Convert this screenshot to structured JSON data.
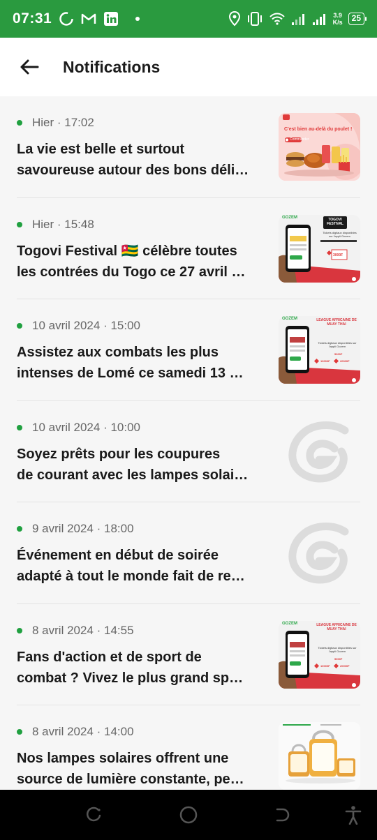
{
  "status_bar": {
    "time": "07:31",
    "net_speed_top": "3.9",
    "net_speed_bottom": "K/s",
    "battery": "25"
  },
  "header": {
    "title": "Notifications"
  },
  "notifications": [
    {
      "date": "Hier · 17:02",
      "title_line1": "La vie est belle et surtout",
      "title_line2": "savoureuse autour des bons déli…",
      "thumb": "poulet-promo",
      "thumb_text": {
        "headline": "C'est bien au-delà du poulet !",
        "cta": "Commander"
      }
    },
    {
      "date": "Hier · 15:48",
      "title_line1": "Togovi Festival 🇹🇬 célèbre toutes",
      "title_line2": "les contrées du Togo ce 27 avril …",
      "thumb": "gozem-ticket",
      "thumb_text": {
        "brand": "GOZEM",
        "banner": "TOGOVI FESTIVAL",
        "tagline": "Tickets digitaux disponibles sur l'appli Gozem",
        "price": "3000F"
      }
    },
    {
      "date": "10 avril 2024 · 15:00",
      "title_line1": "Assistez aux combats les plus",
      "title_line2": "intenses de Lomé ce samedi 13 …",
      "thumb": "gozem-muay",
      "thumb_text": {
        "brand": "GOZEM",
        "banner": "LEAGUE AFRICAINE DE MUAY THAI",
        "tagline": "Tickets digitaux disponibles sur l'appli Gozem",
        "price1": "5000F",
        "price2": "10000F",
        "price3": "20000F"
      }
    },
    {
      "date": "10 avril 2024 · 10:00",
      "title_line1": "Soyez prêts pour les coupures",
      "title_line2": "de courant avec les lampes solai…",
      "thumb": "logo"
    },
    {
      "date": "9 avril 2024 · 18:00",
      "title_line1": "Événement en début de soirée",
      "title_line2": "adapté à tout le monde fait de re…",
      "thumb": "logo"
    },
    {
      "date": "8 avril 2024 · 14:55",
      "title_line1": "Fans d'action et de sport de",
      "title_line2": "combat ? Vivez le plus grand sp…",
      "thumb": "gozem-muay",
      "thumb_text": {
        "brand": "GOZEM",
        "banner": "LEAGUE AFRICAINE DE MUAY THAI",
        "tagline": "Tickets digitaux disponibles sur l'appli Gozem",
        "price1": "5000F",
        "price2": "10000F",
        "price3": "20000F"
      }
    },
    {
      "date": "8 avril 2024 · 14:00",
      "title_line1": "Nos lampes solaires offrent une",
      "title_line2": "source de lumière constante, pe…",
      "thumb": "lamp"
    }
  ],
  "colors": {
    "status_green": "#2a9a3f",
    "unread_dot": "#20a040",
    "gozem_green": "#2ea84a",
    "promo_red": "#e03a3a"
  }
}
